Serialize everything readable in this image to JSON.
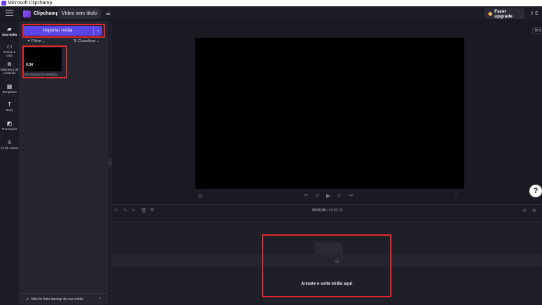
{
  "window": {
    "title": "Microsoft Clipchamp"
  },
  "topbar": {
    "brand": "Clipchamp",
    "video_title": "Vídeo sem título",
    "upgrade_label": "Fazer upgrade",
    "export_label": "E"
  },
  "nav": [
    {
      "label": "Sua mídia",
      "icon": "folder-icon"
    },
    {
      "label": "Gravar e criar",
      "icon": "camera-icon"
    },
    {
      "label": "Biblioteca de conteúdo",
      "icon": "library-icon"
    },
    {
      "label": "Templates",
      "icon": "templates-icon"
    },
    {
      "label": "Texto",
      "icon": "text-icon"
    },
    {
      "label": "Transições",
      "icon": "transitions-icon"
    },
    {
      "label": "Kit de marca",
      "icon": "brand-kit-icon"
    }
  ],
  "media": {
    "import_label": "Importar mídia",
    "filter_label": "Filtrar",
    "sort_label": "Classificar",
    "item": {
      "duration": "0:34",
      "name": "VID-20240210-WA0011..."
    },
    "backup_text": "Não foi feito backup da sua mídia"
  },
  "stage": {
    "aspect_ratio": "16:9"
  },
  "timeline": {
    "current_time": "00:00.00",
    "total_time": "00:00.00",
    "drop_text": "Arraste e solte mídia aqui"
  },
  "help": {
    "label": "?"
  },
  "colors": {
    "accent": "#5b45e6",
    "highlight": "#e0262e",
    "background": "#1f1f2a"
  }
}
